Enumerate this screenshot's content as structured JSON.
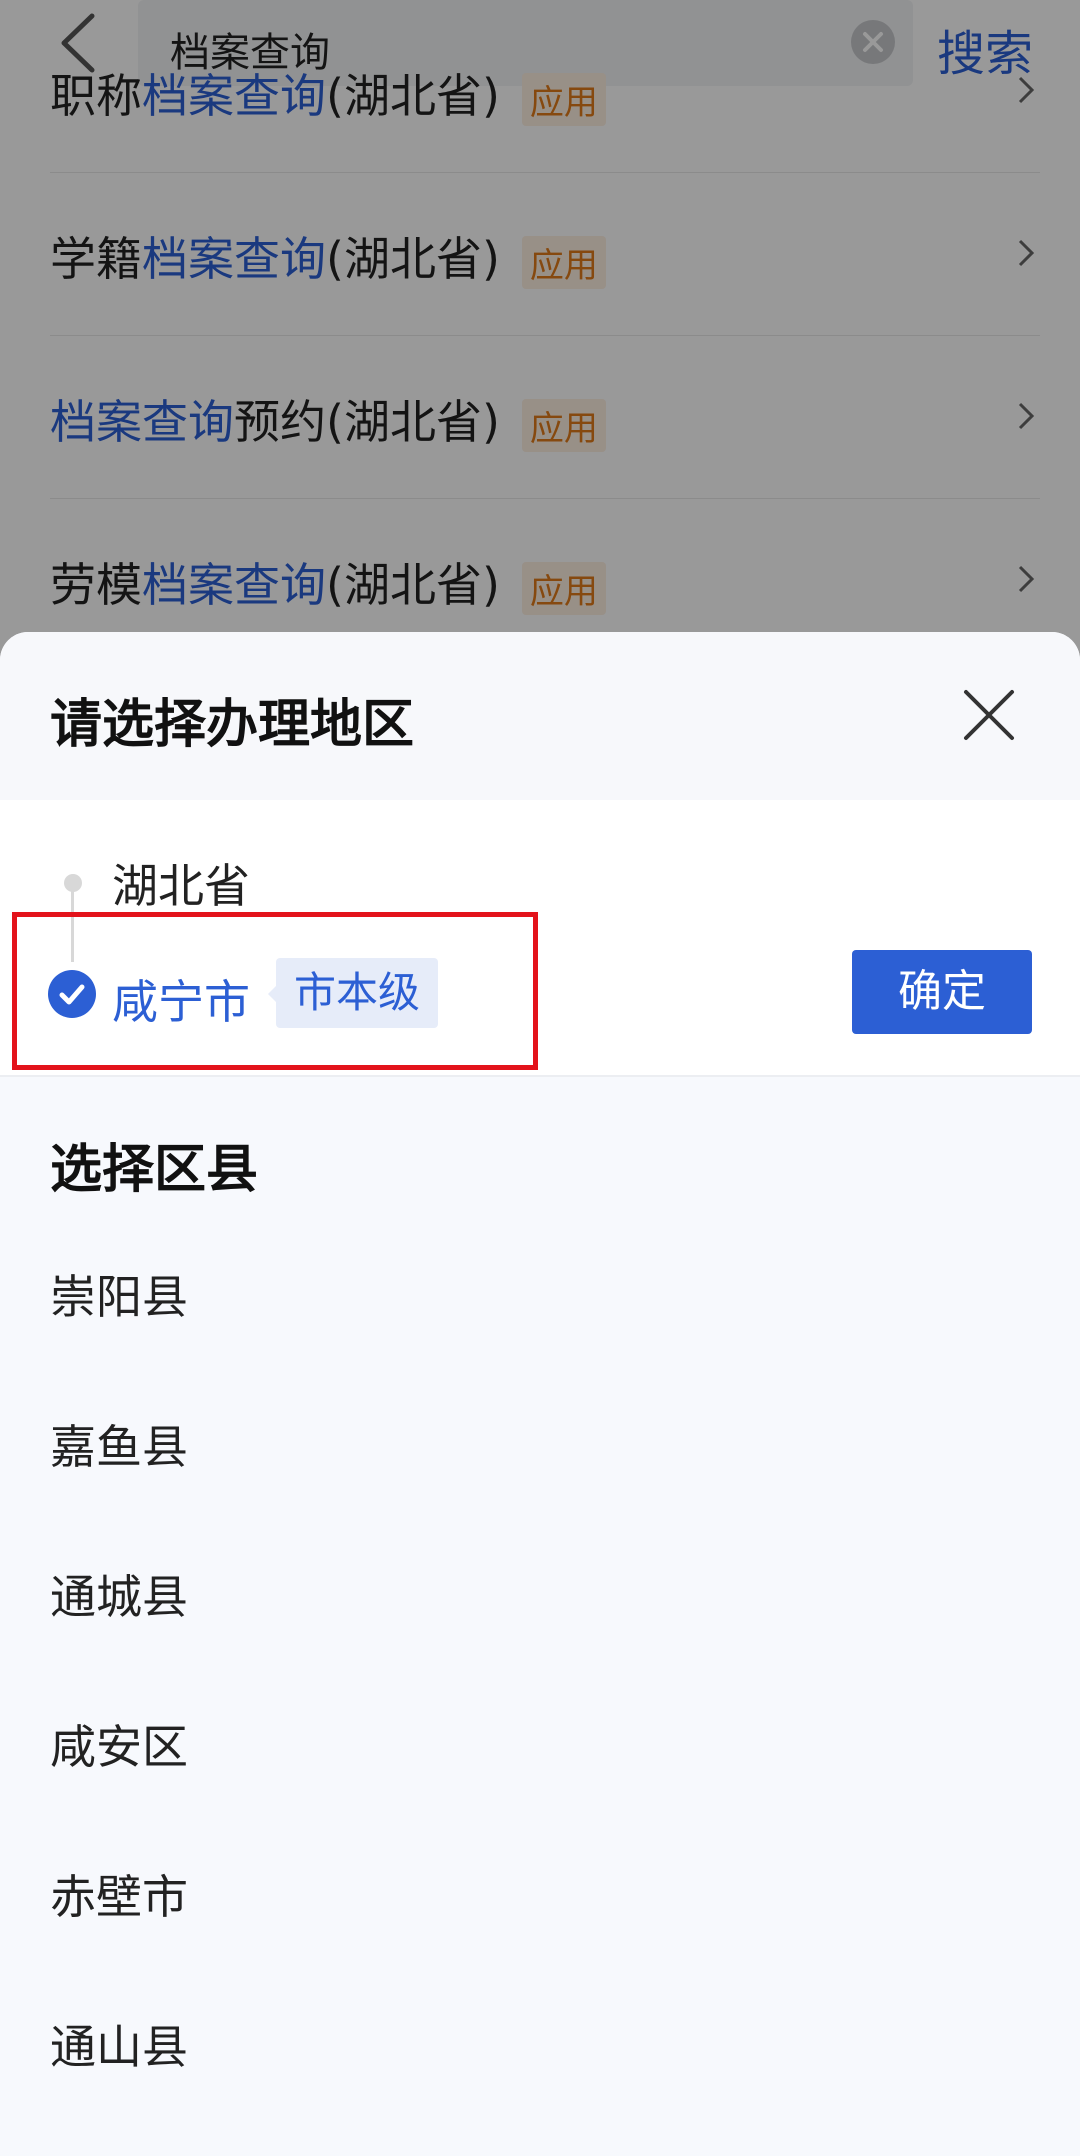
{
  "search": {
    "query": "档案查询",
    "search_label": "搜索"
  },
  "results": [
    {
      "prefix": "职称",
      "highlight": "档案查询",
      "suffix": "(湖北省)",
      "tag": "应用"
    },
    {
      "prefix": "学籍",
      "highlight": "档案查询",
      "suffix": "(湖北省)",
      "tag": "应用"
    },
    {
      "prefix": "",
      "highlight": "档案查询",
      "suffix": "预约(湖北省)",
      "tag": "应用"
    },
    {
      "prefix": "劳模",
      "highlight": "档案查询",
      "suffix": "(湖北省)",
      "tag": "应用"
    }
  ],
  "sheet": {
    "title": "请选择办理地区",
    "path": {
      "province": "湖北省",
      "city": "咸宁市",
      "level": "市本级"
    },
    "confirm_label": "确定",
    "district_heading": "选择区县",
    "districts": [
      "崇阳县",
      "嘉鱼县",
      "通城县",
      "咸安区",
      "赤壁市",
      "通山县"
    ]
  },
  "icons": {
    "back": "chevron-left-icon",
    "clear": "clear-circle-icon",
    "row_chevron": "chevron-right-icon",
    "close": "close-icon",
    "check": "check-circle-icon"
  },
  "colors": {
    "accent": "#2c5fd4",
    "tag_text": "#e07b1a",
    "highlight_border": "#e3131b"
  }
}
